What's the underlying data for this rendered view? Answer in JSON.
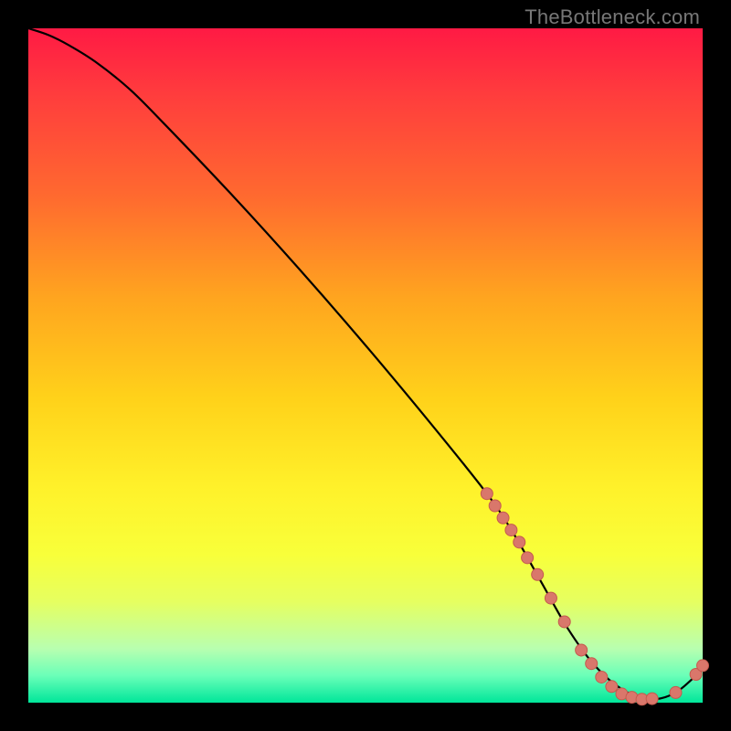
{
  "watermark": "TheBottleneck.com",
  "colors": {
    "background": "#000000",
    "curve": "#000000",
    "marker_fill": "#d9776b",
    "marker_stroke": "#c55a4e"
  },
  "chart_data": {
    "type": "line",
    "title": "",
    "xlabel": "",
    "ylabel": "",
    "xlim": [
      0,
      100
    ],
    "ylim": [
      0,
      100
    ],
    "curve": {
      "x": [
        0,
        3,
        6,
        10,
        15,
        20,
        30,
        40,
        50,
        60,
        68,
        72,
        76,
        80,
        84,
        88,
        92,
        96,
        100
      ],
      "y": [
        100,
        99,
        97.5,
        95,
        91,
        86,
        75.5,
        64.5,
        53,
        41,
        31,
        25,
        18,
        11,
        5.5,
        2,
        0.5,
        1.5,
        5
      ]
    },
    "markers": [
      {
        "x": 68.0,
        "y": 31.0
      },
      {
        "x": 69.2,
        "y": 29.2
      },
      {
        "x": 70.4,
        "y": 27.4
      },
      {
        "x": 71.6,
        "y": 25.6
      },
      {
        "x": 72.8,
        "y": 23.8
      },
      {
        "x": 74.0,
        "y": 21.5
      },
      {
        "x": 75.5,
        "y": 19.0
      },
      {
        "x": 77.5,
        "y": 15.5
      },
      {
        "x": 79.5,
        "y": 12.0
      },
      {
        "x": 82.0,
        "y": 7.8
      },
      {
        "x": 83.5,
        "y": 5.8
      },
      {
        "x": 85.0,
        "y": 3.8
      },
      {
        "x": 86.5,
        "y": 2.4
      },
      {
        "x": 88.0,
        "y": 1.3
      },
      {
        "x": 89.5,
        "y": 0.8
      },
      {
        "x": 91.0,
        "y": 0.5
      },
      {
        "x": 92.5,
        "y": 0.6
      },
      {
        "x": 96.0,
        "y": 1.5
      },
      {
        "x": 99.0,
        "y": 4.2
      },
      {
        "x": 100.0,
        "y": 5.5
      }
    ]
  }
}
